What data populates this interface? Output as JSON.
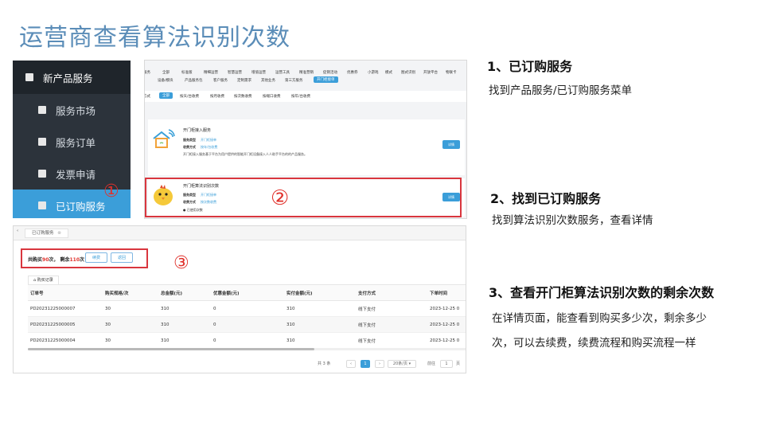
{
  "slide_title": "运营商查看算法识别次数",
  "markers": {
    "one": "①",
    "two": "②",
    "three": "③"
  },
  "sidebar": {
    "top_label": "新产品服务",
    "items": [
      {
        "label": "服务市场",
        "active": false
      },
      {
        "label": "服务订单",
        "active": false
      },
      {
        "label": "发票申请",
        "active": false
      },
      {
        "label": "已订购服务",
        "active": true
      }
    ]
  },
  "services_shot": {
    "nav1": [
      "服务",
      "全部",
      "标准版",
      "精细运营",
      "智慧运营",
      "增值运营",
      "运营工具",
      "精准营销",
      "促销活动",
      "优惠券",
      "小游戏",
      "模式",
      "图式识别",
      "开放平台",
      "物联卡"
    ],
    "nav2": [
      "设备/模块",
      "产品服务包",
      "客户服务",
      "定制需求",
      "其他业务",
      "第三方服务",
      "开门柜接单"
    ],
    "nav3": [
      "方式",
      "全部",
      "按天/台收费",
      "按月收费",
      "按次数收费",
      "按端口收费",
      "按年/台收费"
    ],
    "card1": {
      "title": "开门柜接入服务",
      "type_label": "服务类型",
      "type_value": "开门柜接单",
      "fee_label": "收费方式",
      "fee_value": "按年/台收费",
      "desc": "开门柜接入服务基于平台为用户提供的智能开门柜设备接入人人助手平台的的产品服务。",
      "detail": "详情"
    },
    "card2": {
      "title": "开门柜算法识别次数",
      "type_label": "服务类型",
      "type_value": "开门柜接单",
      "fee_label": "收费方式",
      "fee_value": "按次数收费",
      "extra": "● 已使用次数",
      "detail": "详情"
    }
  },
  "orders_shot": {
    "tab": "已订购服务",
    "buy_prefix": "共购买",
    "buy_count": "90",
    "buy_unit": "次，",
    "remain_prefix": "剩余",
    "remain_count": "110",
    "remain_unit": "次",
    "renew_button": "续费",
    "back_button": "返回",
    "records_tab": "购买记录",
    "columns": [
      "订单号",
      "购买规格/次",
      "总金额(元)",
      "优惠金额(元)",
      "实付金额(元)",
      "支付方式",
      "下单时间"
    ],
    "rows": [
      [
        "PD20231225000007",
        "30",
        "310",
        "0",
        "310",
        "线下支付",
        "2023-12-25 0"
      ],
      [
        "PD20231225000005",
        "30",
        "310",
        "0",
        "310",
        "线下支付",
        "2023-12-25 0"
      ],
      [
        "PD20231225000004",
        "30",
        "310",
        "0",
        "310",
        "线下支付",
        "2023-12-25 0"
      ]
    ],
    "pager": {
      "total": "共 3 条",
      "prev": "‹",
      "page": "1",
      "next": "›",
      "size": "20条/页",
      "goto": "前往",
      "goto_page": "1",
      "goto_unit": "页"
    }
  },
  "steps": [
    {
      "title": "1、已订购服务",
      "desc": [
        "找到产品服务/已订购服务菜单"
      ]
    },
    {
      "title": "2、找到已订购服务",
      "desc": [
        "找到算法识别次数服务，查看详情"
      ]
    },
    {
      "title": "3、查看开门柜算法识别次数的剩余次数",
      "desc": [
        "在详情页面，能查看到购买多少次，剩余多少",
        "次，可以去续费，续费流程和购买流程一样"
      ]
    }
  ],
  "colors": {
    "title": "#5b8db8",
    "accent": "#3b9ed9",
    "highlight": "#d9363e"
  }
}
